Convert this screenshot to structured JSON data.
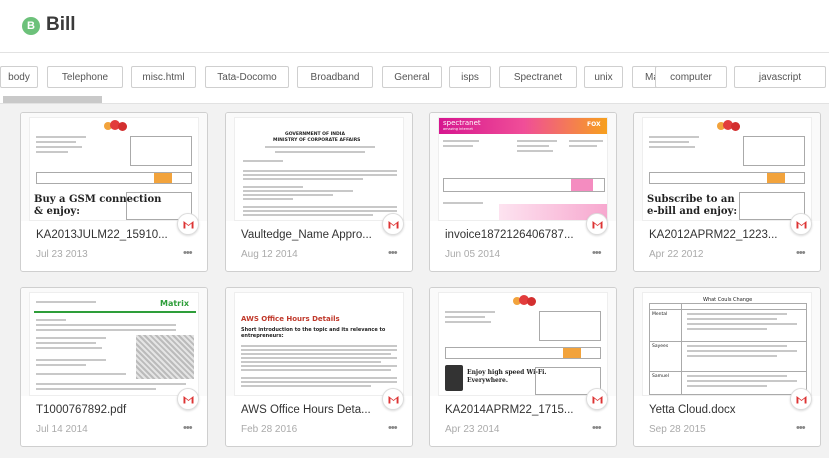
{
  "header": {
    "avatar_letter": "B",
    "title": "Bill"
  },
  "tags": [
    "body",
    "Telephone",
    "misc.html",
    "Tata-Docomo",
    "Broadband",
    "General",
    "isps",
    "Spectranet",
    "unix",
    "May",
    "computer",
    "javascript"
  ],
  "cards": [
    {
      "name": "KA2013JULM22_15910...",
      "date": "Jul 23 2013",
      "preview": {
        "headline1": "Buy a GSM connection",
        "headline2": "& enjoy:"
      }
    },
    {
      "name": "Vaultedge_Name Appro...",
      "date": "Aug 12 2014",
      "preview": {
        "line1": "GOVERNMENT OF INDIA",
        "line2": "MINISTRY OF CORPORATE AFFAIRS"
      }
    },
    {
      "name": "invoice1872126406787...",
      "date": "Jun 05 2014",
      "preview": {
        "brand": "spectranet",
        "brand_sub": "amazing internet",
        "corner": "FOX"
      }
    },
    {
      "name": "KA2012APRM22_1223...",
      "date": "Apr 22 2012",
      "preview": {
        "headline1": "Subscribe to an",
        "headline2": "e-bill and enjoy:"
      }
    },
    {
      "name": "T1000767892.pdf",
      "date": "Jul 14 2014",
      "preview": {
        "brand": "Matrix"
      }
    },
    {
      "name": "AWS Office Hours Deta...",
      "date": "Feb 28 2016",
      "preview": {
        "heading": "AWS Office Hours Details",
        "sub": "Short introduction to the topic and its relevance to entrepreneurs:"
      }
    },
    {
      "name": "KA2014APRM22_1715...",
      "date": "Apr 23 2014",
      "preview": {
        "headline1": "Enjoy high speed Wi-Fi.",
        "headline2": "Everywhere."
      }
    },
    {
      "name": "Yetta Cloud.docx",
      "date": "Sep 28 2015",
      "preview": {
        "heading": "What Couls Change",
        "rows": [
          "Mental",
          "Sayees",
          "Samuel"
        ]
      }
    }
  ],
  "more_label": "•••",
  "colors": {
    "avatar": "#6cc17a",
    "gmail_red": "#d33",
    "accent_orange": "#f2a33c",
    "spectranet_pink": "#d6168f"
  }
}
